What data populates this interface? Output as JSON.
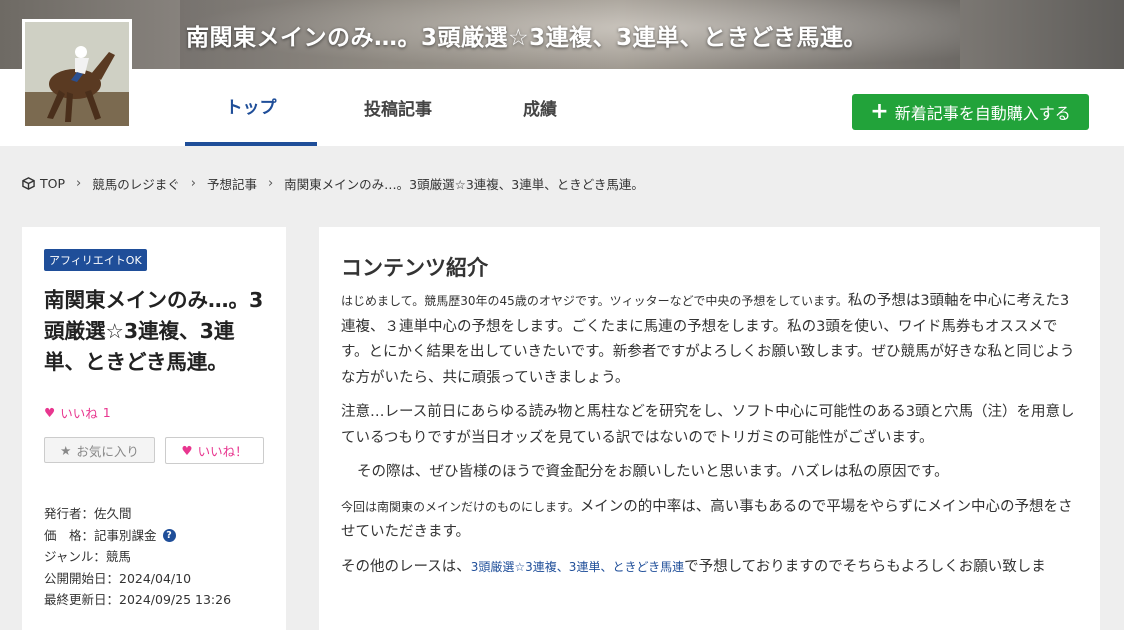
{
  "header": {
    "title": "南関東メインのみ…。3頭厳選☆3連複、3連単、ときどき馬連。"
  },
  "nav": {
    "tabs": [
      {
        "label": "トップ",
        "active": true
      },
      {
        "label": "投稿記事",
        "active": false
      },
      {
        "label": "成績",
        "active": false
      }
    ],
    "buy_button": "新着記事を自動購入する"
  },
  "breadcrumb": [
    "TOP",
    "競馬のレジまぐ",
    "予想記事",
    "南関東メインのみ…。3頭厳選☆3連複、3連単、ときどき馬連。"
  ],
  "sidebar": {
    "badge": "アフィリエイトOK",
    "title": "南関東メインのみ…。3頭厳選☆3連複、3連単、ときどき馬連。",
    "likes_label": "いいね",
    "likes_count": "1",
    "favorite_button": "お気に入り",
    "like_button": "いいね！",
    "meta": {
      "publisher": "発行者：佐久間",
      "price": "価　格：記事別課金",
      "genre": "ジャンル：競馬",
      "start_date": "公開開始日：2024/04/10",
      "updated": "最終更新日：2024/09/25 13:26"
    }
  },
  "main": {
    "heading": "コンテンツ紹介",
    "p1_small": "はじめまして。競馬歴30年の45歳のオヤジです。ツィッターなどで中央の予想をしています。",
    "p1_rest": "私の予想は3頭軸を中心に考えた3連複、３連単中心の予想をします。ごくたまに馬連の予想をします。私の3頭を使い、ワイド馬券もオススメです。とにかく結果を出していきたいです。新参者ですがよろしくお願い致します。ぜひ競馬が好きな私と同じような方がいたら、共に頑張っていきましょう。",
    "p2": "注意…レース前日にあらゆる読み物と馬柱などを研究をし、ソフト中心に可能性のある3頭と穴馬（注）を用意しているつもりですが当日オッズを見ている訳ではないのでトリガミの可能性がございます。",
    "p3": "その際は、ぜひ皆様のほうで資金配分をお願いしたいと思います。ハズレは私の原因です。",
    "p4_small": "今回は南関東のメインだけのものにします。",
    "p4_rest": "メインの的中率は、高い事もあるので平場をやらずにメイン中心の予想をさせていただきます。",
    "p5_start": "その他のレースは、",
    "p5_link": "3頭厳選☆3連複、3連単、ときどき馬連",
    "p5_end": "で予想しておりますのでそちらもよろしくお願い致しま"
  },
  "colors": {
    "accent": "#1f4e99",
    "buy_green": "#22a33a",
    "like_pink": "#e8368f"
  }
}
